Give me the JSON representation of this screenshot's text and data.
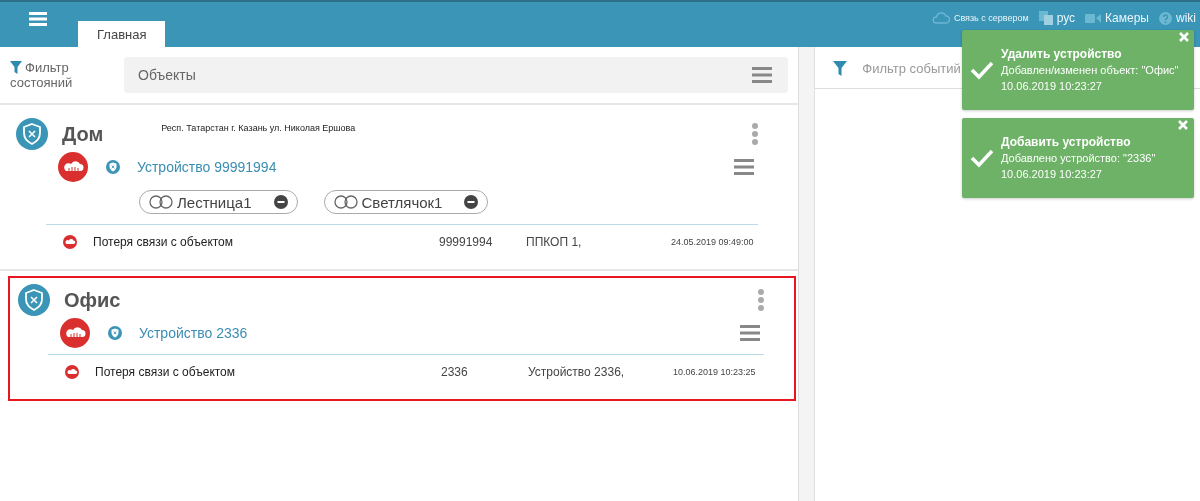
{
  "topbar": {
    "tabs": [
      {
        "label": "Главная",
        "selected": true
      }
    ],
    "links": [
      {
        "kind": "server",
        "label": "Связь с сервером"
      },
      {
        "kind": "lang",
        "label": "рус"
      },
      {
        "kind": "camera",
        "label": "Камеры"
      },
      {
        "kind": "help",
        "label": "wiki"
      }
    ]
  },
  "left_panel": {
    "filter_label": "Фильтр состояний",
    "search": {
      "value": "Объекты"
    },
    "objects": [
      {
        "name": "Дом",
        "address": "Респ. Татарстан г. Казань ул. Николая Ершова",
        "selected": false,
        "device": "Устройство 99991994",
        "zones": [
          {
            "label": "Лестница1"
          },
          {
            "label": "Светлячок1"
          }
        ],
        "events": [
          {
            "text": "Потеря связи с объектом",
            "column_2": "99991994",
            "column_3": "ППКОП 1,",
            "time": "24.05.2019 09:49:00"
          }
        ]
      },
      {
        "name": "Офис",
        "selected": true,
        "device": "Устройство 2336",
        "events": [
          {
            "text": "Потеря связи с объектом",
            "column_2": "2336",
            "column_3": "Устройство 2336,",
            "time": "10.06.2019 10:23:25"
          }
        ]
      }
    ]
  },
  "right_panel": {
    "filter_label": "Фильтр событий"
  },
  "notifications": [
    {
      "title": "Удалить устройство",
      "message": "Добавлен/изменен объект: \"Офис\"",
      "time": "10.06.2019 10:23:27"
    },
    {
      "title": "Добавить устройство",
      "message": "Добавлено устройство: \"2336\"",
      "time": "10.06.2019 10:23:27"
    }
  ]
}
